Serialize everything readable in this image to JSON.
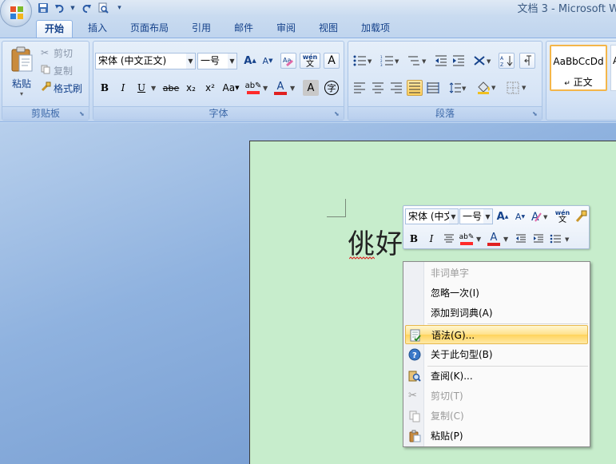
{
  "window": {
    "title": "文档 3 - Microsoft W"
  },
  "quick_access": {
    "icons": [
      "save-icon",
      "undo-icon",
      "redo-icon",
      "print-preview-icon",
      "customize-arrow-icon"
    ]
  },
  "tabs": [
    {
      "label": "开始",
      "active": true
    },
    {
      "label": "插入"
    },
    {
      "label": "页面布局"
    },
    {
      "label": "引用"
    },
    {
      "label": "邮件"
    },
    {
      "label": "审阅"
    },
    {
      "label": "视图"
    },
    {
      "label": "加载项"
    }
  ],
  "clipboard": {
    "paste_label": "粘贴",
    "cut_label": "剪切",
    "copy_label": "复制",
    "format_painter_label": "格式刷",
    "group_label": "剪贴板"
  },
  "font": {
    "font_name": "宋体 (中文正文)",
    "font_size": "一号",
    "bold": "B",
    "italic": "I",
    "underline": "U",
    "strikethrough": "abe",
    "subscript": "x₂",
    "superscript": "x²",
    "change_case": "Aa",
    "char_shading": "A",
    "font_color": "A",
    "phonetic": "wén",
    "enclose": "字",
    "group_label": "字体"
  },
  "paragraph": {
    "group_label": "段落"
  },
  "styles": {
    "preview_text": "AaBbCcDd",
    "normal_label": "正文",
    "next_preview": "A"
  },
  "document": {
    "text": "佻好"
  },
  "mini_toolbar": {
    "font_name": "宋体 (中文",
    "font_size": "一号",
    "bold": "B",
    "italic": "I",
    "phonetic": "wén"
  },
  "context_menu": {
    "items": [
      {
        "label": "非词单字",
        "disabled": true
      },
      {
        "label": "忽略一次(I)"
      },
      {
        "label": "添加到词典(A)"
      },
      {
        "label": "语法(G)...",
        "highlighted": true
      },
      {
        "label": "关于此句型(B)"
      },
      {
        "label": "查阅(K)..."
      },
      {
        "label": "剪切(T)",
        "disabled": true
      },
      {
        "label": "复制(C)",
        "disabled": true
      },
      {
        "label": "粘贴(P)"
      }
    ]
  },
  "colors": {
    "highlight_yellow": "#ffe18a",
    "font_red": "#e02020",
    "page_bg": "#c7edcc",
    "ribbon_text": "#15428b"
  }
}
